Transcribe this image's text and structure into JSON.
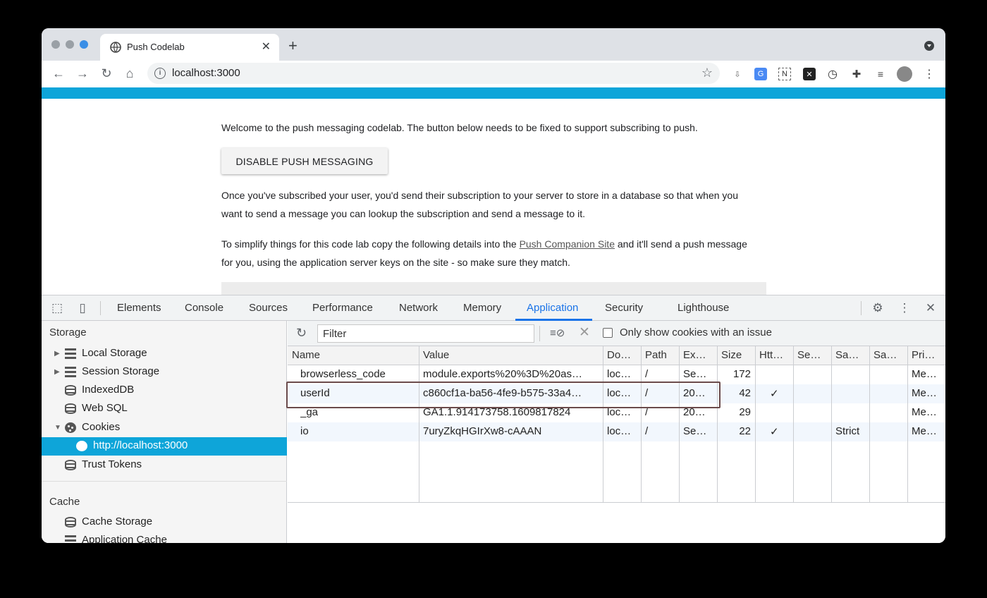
{
  "browser": {
    "tab_title": "Push Codelab",
    "url": "localhost:3000",
    "accent_color": "#0ea5d9"
  },
  "page": {
    "intro": "Welcome to the push messaging codelab. The button below needs to be fixed to support subscribing to push.",
    "button_label": "DISABLE PUSH MESSAGING",
    "para2": "Once you've subscribed your user, you'd send their subscription to your server to store in a database so that when you want to send a message you can lookup the subscription and send a message to it.",
    "para3_before": "To simplify things for this code lab copy the following details into the ",
    "para3_link": "Push Companion Site",
    "para3_after": " and it'll send a push message for you, using the application server keys on the site - so make sure they match."
  },
  "devtools": {
    "tabs": [
      "Elements",
      "Console",
      "Sources",
      "Performance",
      "Network",
      "Memory",
      "Application",
      "Security",
      "Lighthouse"
    ],
    "active_tab": "Application",
    "sidebar": {
      "storage_header": "Storage",
      "items": [
        "Local Storage",
        "Session Storage",
        "IndexedDB",
        "Web SQL",
        "Cookies",
        "http://localhost:3000",
        "Trust Tokens"
      ],
      "cache_header": "Cache",
      "cache_items": [
        "Cache Storage",
        "Application Cache"
      ]
    },
    "filter_placeholder": "Filter",
    "only_issue_label": "Only show cookies with an issue",
    "columns": [
      "Name",
      "Value",
      "Do…",
      "Path",
      "Ex…",
      "Size",
      "Htt…",
      "Se…",
      "Sa…",
      "Sa…",
      "Pri…"
    ],
    "rows": [
      {
        "name": "browserless_code",
        "value": "module.exports%20%3D%20as…",
        "domain": "loc…",
        "path": "/",
        "expires": "Se…",
        "size": "172",
        "http": "",
        "secure": "",
        "samesite": "",
        "sameparty": "",
        "priority": "Me…"
      },
      {
        "name": "userId",
        "value": "c860cf1a-ba56-4fe9-b575-33a4…",
        "domain": "loc…",
        "path": "/",
        "expires": "20…",
        "size": "42",
        "http": "✓",
        "secure": "",
        "samesite": "",
        "sameparty": "",
        "priority": "Me…"
      },
      {
        "name": "_ga",
        "value": "GA1.1.914173758.1609817824",
        "domain": "loc…",
        "path": "/",
        "expires": "20…",
        "size": "29",
        "http": "",
        "secure": "",
        "samesite": "",
        "sameparty": "",
        "priority": "Me…"
      },
      {
        "name": "io",
        "value": "7uryZkqHGIrXw8-cAAAN",
        "domain": "loc…",
        "path": "/",
        "expires": "Se…",
        "size": "22",
        "http": "✓",
        "secure": "",
        "samesite": "Strict",
        "sameparty": "",
        "priority": "Me…"
      }
    ]
  }
}
